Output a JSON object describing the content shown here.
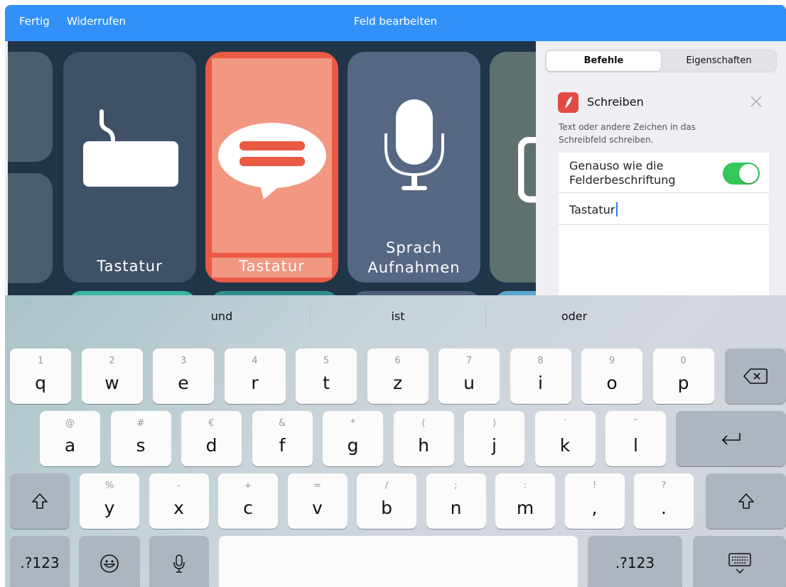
{
  "topbar": {
    "done": "Fertig",
    "undo": "Widerrufen",
    "title": "Feld bearbeiten"
  },
  "grid": {
    "tiles": [
      {
        "label": "Tastatur"
      },
      {
        "label": "Tastatur"
      },
      {
        "label_line1": "Sprach",
        "label_line2": "Aufnahmen"
      }
    ]
  },
  "panel": {
    "tabs": [
      "Befehle",
      "Eigenschaften"
    ],
    "command": {
      "title": "Schreiben",
      "description": "Text oder andere Zeichen in das Schreibfeld schreiben."
    },
    "same_as_label": "Genauso wie die Felderbeschriftung",
    "toggle_on": true,
    "text_value": "Tastatur"
  },
  "keyboard": {
    "suggestions": [
      "und",
      "ist",
      "oder"
    ],
    "row1": [
      {
        "alt": "1",
        "main": "q"
      },
      {
        "alt": "2",
        "main": "w"
      },
      {
        "alt": "3",
        "main": "e"
      },
      {
        "alt": "4",
        "main": "r"
      },
      {
        "alt": "5",
        "main": "t"
      },
      {
        "alt": "6",
        "main": "z"
      },
      {
        "alt": "7",
        "main": "u"
      },
      {
        "alt": "8",
        "main": "i"
      },
      {
        "alt": "9",
        "main": "o"
      },
      {
        "alt": "0",
        "main": "p"
      }
    ],
    "row2": [
      {
        "alt": "@",
        "main": "a"
      },
      {
        "alt": "#",
        "main": "s"
      },
      {
        "alt": "€",
        "main": "d"
      },
      {
        "alt": "&",
        "main": "f"
      },
      {
        "alt": "*",
        "main": "g"
      },
      {
        "alt": "(",
        "main": "h"
      },
      {
        "alt": ")",
        "main": "j"
      },
      {
        "alt": "′",
        "main": "k"
      },
      {
        "alt": "″",
        "main": "l"
      }
    ],
    "row3": [
      {
        "alt": "%",
        "main": "y"
      },
      {
        "alt": "-",
        "main": "x"
      },
      {
        "alt": "+",
        "main": "c"
      },
      {
        "alt": "=",
        "main": "v"
      },
      {
        "alt": "/",
        "main": "b"
      },
      {
        "alt": ";",
        "main": "n"
      },
      {
        "alt": ":",
        "main": "m"
      },
      {
        "alt": "!",
        "main": ","
      },
      {
        "alt": "?",
        "main": "."
      }
    ],
    "numbers_label": ".?123"
  }
}
